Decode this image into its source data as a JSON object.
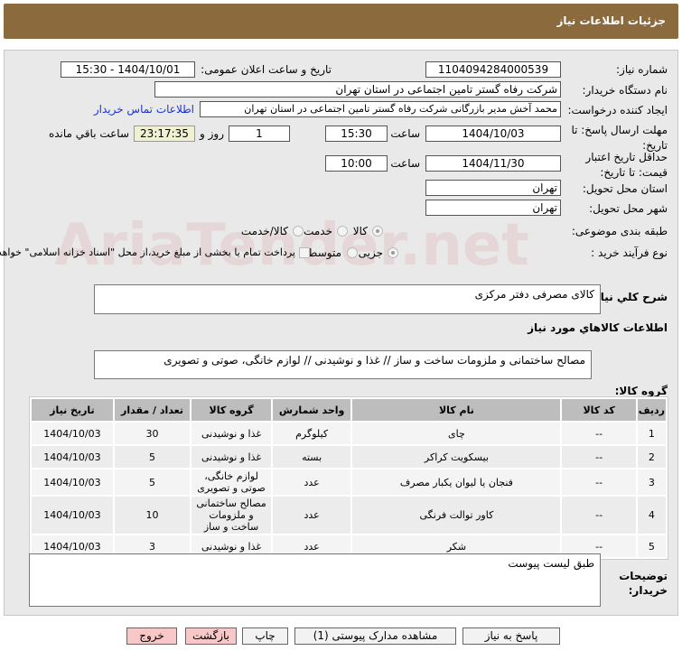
{
  "header": {
    "title": "جزئیات اطلاعات نیاز"
  },
  "form": {
    "need_number_label": "شماره نیاز:",
    "need_number": "1104094284000539",
    "announce_label": "تاریخ و ساعت اعلان عمومی:",
    "announce_value": "1404/10/01 - 15:30",
    "buyer_label": "نام دستگاه خریدار:",
    "buyer": "شرکت رفاه گستر تامین اجتماعی در استان تهران",
    "creator_label": "ایجاد کننده درخواست:",
    "creator": "محمد آخش مدیر بازرگانی شرکت رفاه گستر تامین اجتماعی در استان تهران",
    "contact_link": "اطلاعات تماس خریدار",
    "deadline_label": "مهلت ارسال پاسخ: تا تاریخ:",
    "deadline_date": "1404/10/03",
    "time_label": "ساعت",
    "deadline_time": "15:30",
    "days": "1",
    "days_label": "روز و",
    "remaining": "23:17:35",
    "remaining_label": "ساعت باقي مانده",
    "validity_label": "حداقل تاریخ اعتبار قیمت: تا تاریخ:",
    "validity_date": "1404/11/30",
    "validity_time": "10:00",
    "province_label": "استان محل تحویل:",
    "province": "تهران",
    "city_label": "شهر محل تحویل:",
    "city": "تهران",
    "category_label": "طبقه بندی موضوعی:",
    "category_options": [
      "کالا",
      "خدمت",
      "کالا/خدمت"
    ],
    "purchase_label": "نوع فرآیند خرید :",
    "purchase_options": [
      "جزیی",
      "متوسط"
    ],
    "payment_note": "پرداخت تمام یا بخشی از مبلغ خرید،از محل \"اسناد خزانه اسلامی\" خواهد بود.",
    "description_label": "شرح كلي نياز:",
    "description": "کالای مصرفی دفتر مرکزی",
    "goods_title": "اطلاعات كالاهاي مورد نياز",
    "goods_group_label": "گروه کالا:",
    "goods_group": "مصالح ساختمانی و ملزومات ساخت و ساز // غذا و نوشیدنی // لوازم خانگی، صوتی و تصویری",
    "notes_label": "توضیحات خریدار:",
    "notes": "طبق لیست پیوست"
  },
  "watermark": "AriaTender.net",
  "table": {
    "headers": [
      "ردیف",
      "کد کالا",
      "نام کالا",
      "واحد شمارش",
      "گروه کالا",
      "تعداد / مقدار",
      "تاریخ نیاز"
    ],
    "rows": [
      [
        "1",
        "--",
        "چای",
        "کیلوگرم",
        "غذا و نوشیدنی",
        "30",
        "1404/10/03"
      ],
      [
        "2",
        "--",
        "بیسکویت کراکر",
        "بسته",
        "غذا و نوشیدنی",
        "5",
        "1404/10/03"
      ],
      [
        "3",
        "--",
        "فنجان یا لیوان یکبار مصرف",
        "عدد",
        "لوازم خانگی، صوتی و تصویری",
        "5",
        "1404/10/03"
      ],
      [
        "4",
        "--",
        "کاور توالت فرنگی",
        "عدد",
        "مصالح ساختمانی و ملزومات ساخت و ساز",
        "10",
        "1404/10/03"
      ],
      [
        "5",
        "--",
        "شکر",
        "عدد",
        "غذا و نوشیدنی",
        "3",
        "1404/10/03"
      ]
    ]
  },
  "buttons": {
    "reply": "پاسخ به نیاز",
    "docs": "مشاهده مدارک پیوستی (1)",
    "print": "چاپ",
    "back": "بازگشت",
    "exit": "خروج"
  }
}
